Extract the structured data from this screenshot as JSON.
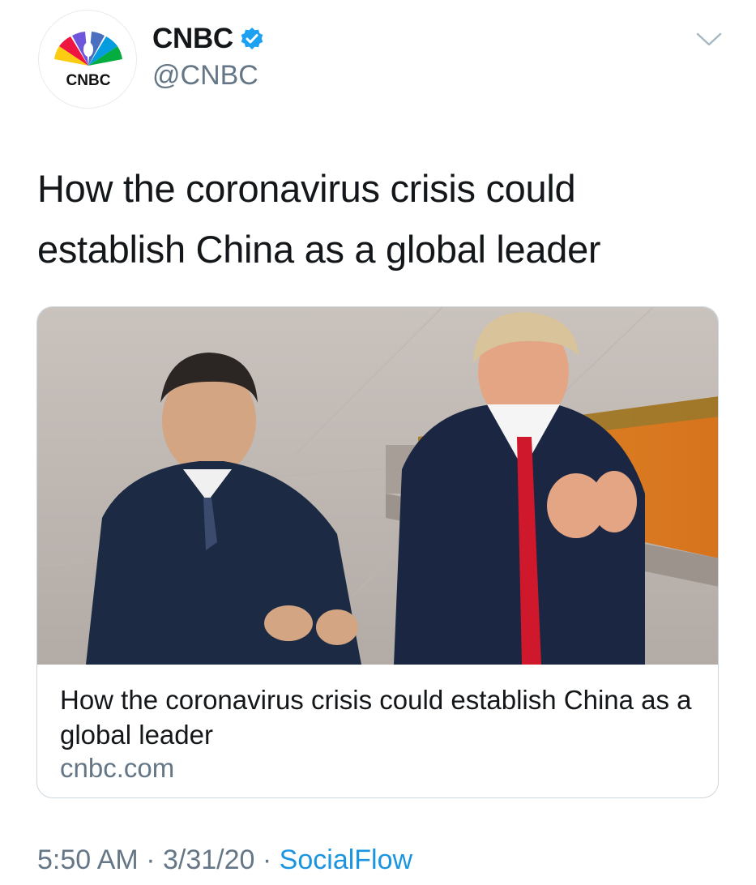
{
  "author": {
    "display_name": "CNBC",
    "handle": "@CNBC",
    "logo_text": "CNBC",
    "verified": true,
    "verified_color": "#1da1f2"
  },
  "tweet": {
    "text": "How the coronavirus crisis could establish China as a global leader"
  },
  "card": {
    "title": "How the coronavirus crisis could establish China as a global leader",
    "domain": "cnbc.com"
  },
  "meta": {
    "time": "5:50 AM",
    "separator": "·",
    "date": "3/31/20",
    "source": "SocialFlow"
  },
  "icons": {
    "menu": "chevron-down-icon",
    "verified": "verified-badge-icon",
    "logo": "cnbc-peacock-logo"
  },
  "colors": {
    "text_primary": "#14171a",
    "text_secondary": "#657786",
    "link": "#1b95e0",
    "border": "#ccd6dd"
  }
}
